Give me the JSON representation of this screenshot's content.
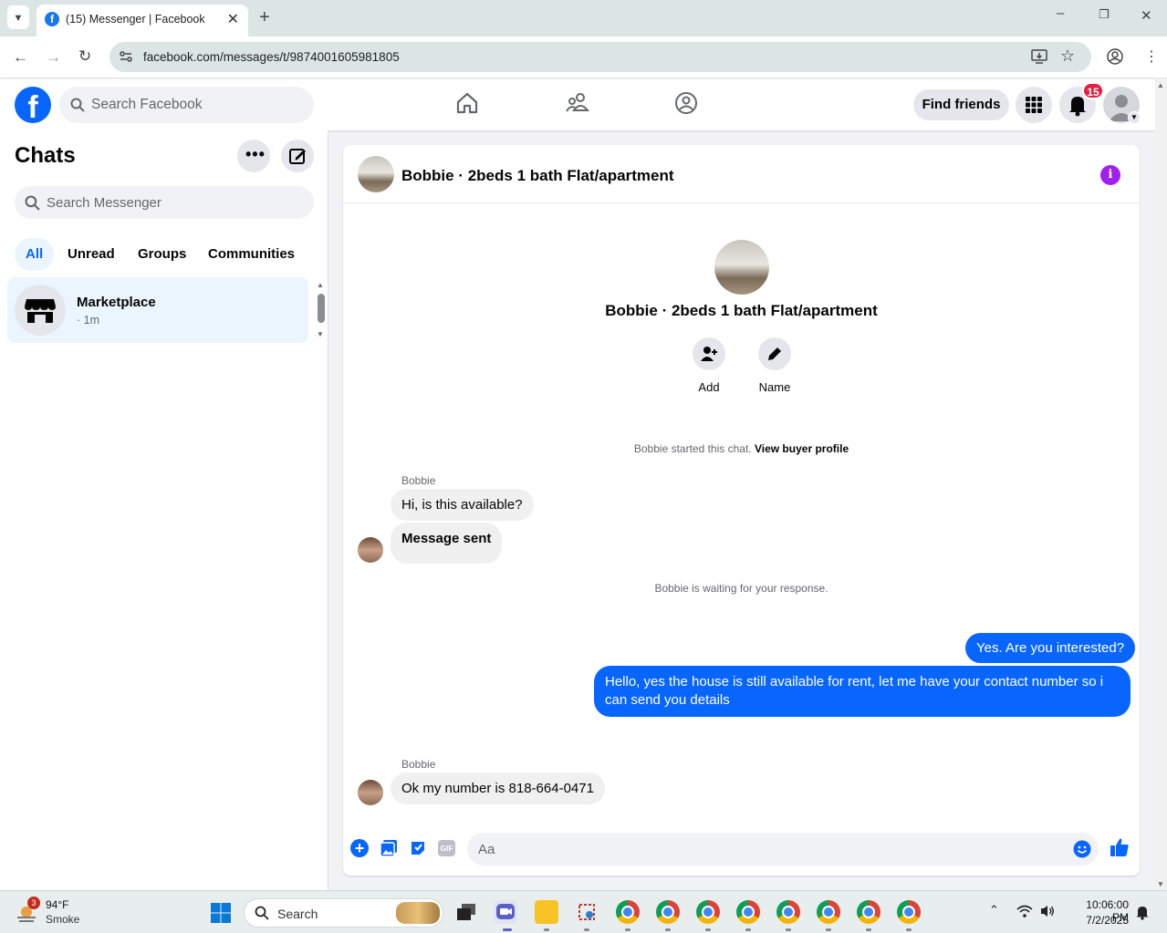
{
  "browser": {
    "tab_title": "(15) Messenger | Facebook",
    "url": "facebook.com/messages/t/9874001605981805"
  },
  "fb_header": {
    "search_placeholder": "Search Facebook",
    "find_friends_label": "Find friends",
    "notification_count": "15"
  },
  "sidebar": {
    "title": "Chats",
    "search_placeholder": "Search Messenger",
    "filters": [
      "All",
      "Unread",
      "Groups",
      "Communities"
    ],
    "active_filter": "All",
    "chats": [
      {
        "name": "Marketplace",
        "time": "· 1m"
      }
    ]
  },
  "conversation": {
    "title": "Bobbie · 2beds 1 bath Flat/apartment",
    "profile_name": "Bobbie · 2beds 1 bath Flat/apartment",
    "actions": {
      "add_label": "Add",
      "name_label": "Name"
    },
    "started_text": "Bobbie started this chat.",
    "view_profile_link": "View buyer profile",
    "waiting_text": "Bobbie is waiting for your response.",
    "messages": [
      {
        "sender": "Bobbie",
        "text": "Hi, is this available?"
      },
      {
        "sender": "Bobbie",
        "text": "Message sent"
      },
      {
        "sender": "me",
        "text": "Yes. Are you interested?"
      },
      {
        "sender": "me",
        "text": "Hello, yes the house is still available for rent, let me have your contact number so i can send you details"
      },
      {
        "sender": "Bobbie",
        "text": "Ok my number is 818-664-0471"
      }
    ],
    "sender_label_1": "Bobbie",
    "sender_label_2": "Bobbie",
    "composer_placeholder": "Aa",
    "gif_label": "GIF"
  },
  "taskbar": {
    "weather_temp": "94°F",
    "weather_desc": "Smoke",
    "weather_badge": "3",
    "search_placeholder": "Search",
    "time": "10:06:00 PM",
    "date": "7/2/2025"
  },
  "colors": {
    "fb_blue": "#0866ff",
    "selected_bg": "#ebf5ff",
    "info_purple": "#a020f0",
    "badge_red": "#e41e3f"
  }
}
